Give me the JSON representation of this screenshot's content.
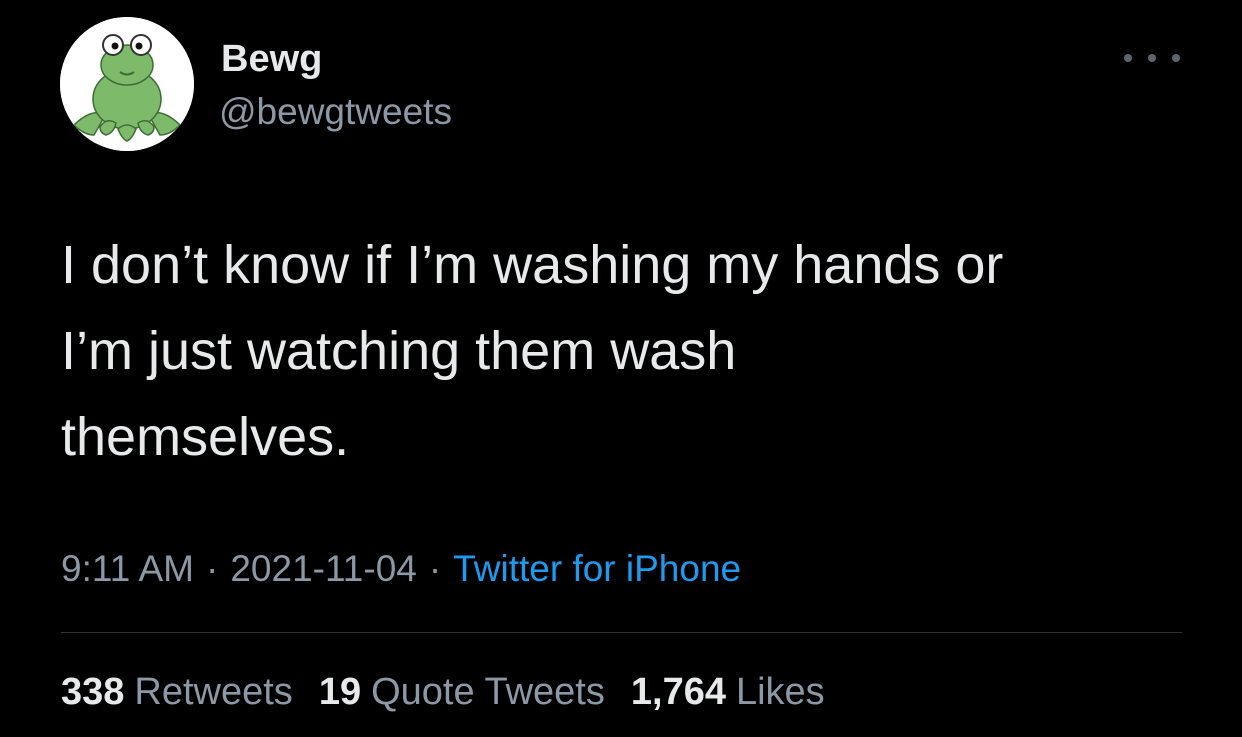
{
  "author": {
    "display_name": "Bewg",
    "handle": "@bewgtweets",
    "avatar_icon": "frog-avatar-icon"
  },
  "menu": {
    "more_icon": "more-dots-icon"
  },
  "tweet": {
    "lines": [
      "I don’t know if I’m washing my hands or",
      "I’m just watching them wash",
      "themselves."
    ],
    "time": "9:11 AM",
    "separator": "·",
    "date": "2021-11-04",
    "source": "Twitter for iPhone"
  },
  "stats": {
    "retweets": {
      "count": "338",
      "label": "Retweets"
    },
    "quote_tweets": {
      "count": "19",
      "label": "Quote Tweets"
    },
    "likes": {
      "count": "1,764",
      "label": "Likes"
    }
  },
  "colors": {
    "background": "#000000",
    "text_primary": "#e7e9ea",
    "text_secondary": "#8b98a5",
    "link": "#1d9bf0",
    "divider": "#2f3336",
    "avatar_frog": "#7dbb6b"
  }
}
